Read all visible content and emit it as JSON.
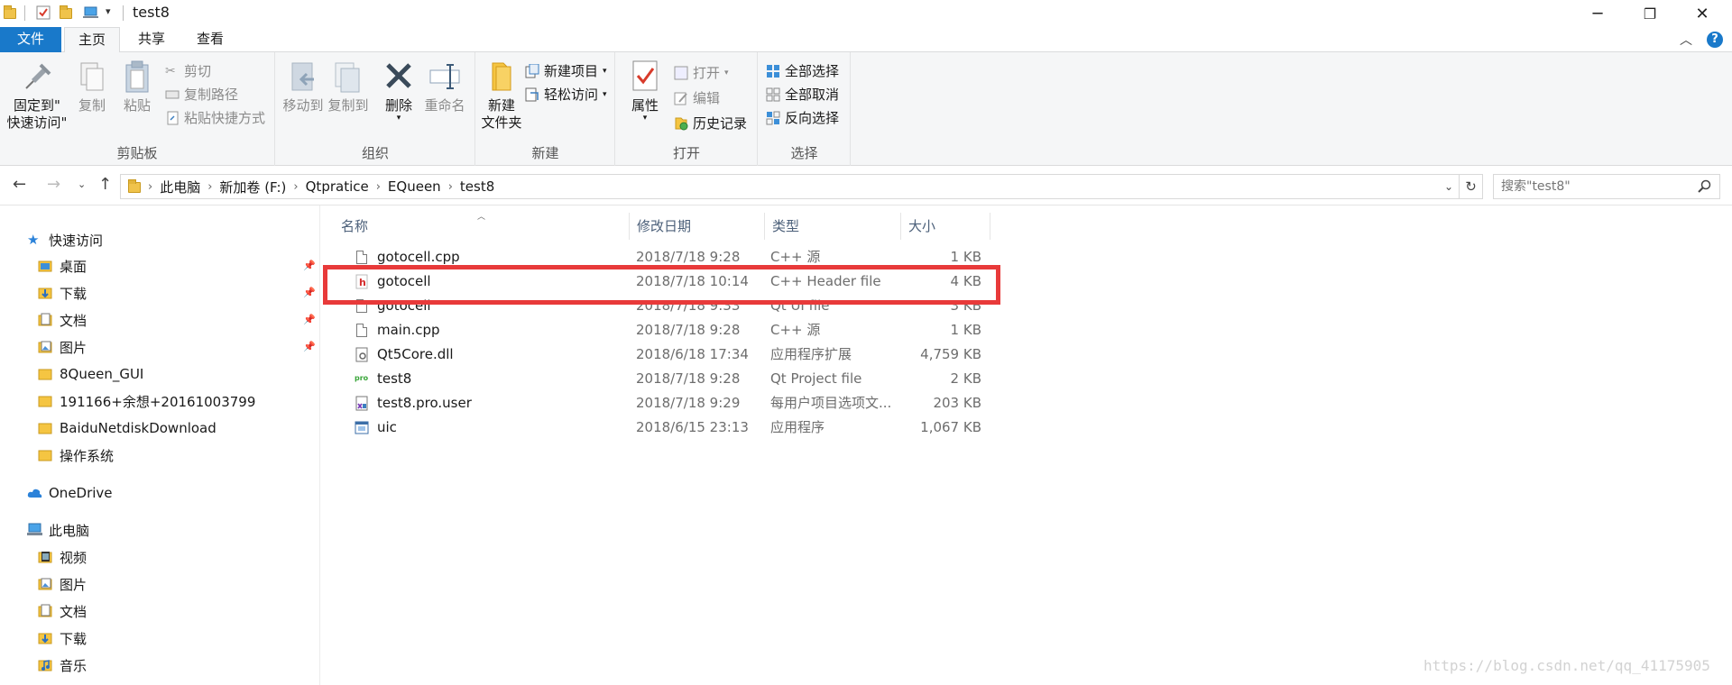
{
  "window": {
    "title": "test8",
    "controls": {
      "minimize": "─",
      "maximize": "❐",
      "close": "✕"
    }
  },
  "ribbon_tabs": [
    {
      "label": "文件"
    },
    {
      "label": "主页"
    },
    {
      "label": "共享"
    },
    {
      "label": "查看"
    }
  ],
  "ribbon": {
    "clipboard": {
      "label": "剪贴板",
      "pin_line1": "固定到\"",
      "pin_line2": "快速访问\"",
      "copy": "复制",
      "paste": "粘贴",
      "cut": "剪切",
      "copy_path": "复制路径",
      "paste_shortcut": "粘贴快捷方式"
    },
    "organize": {
      "label": "组织",
      "move_to": "移动到",
      "copy_to": "复制到",
      "delete": "删除",
      "rename": "重命名"
    },
    "new": {
      "label": "新建",
      "new_folder_line1": "新建",
      "new_folder_line2": "文件夹",
      "new_item": "新建项目",
      "easy_access": "轻松访问"
    },
    "open": {
      "label": "打开",
      "properties": "属性",
      "open": "打开",
      "edit": "编辑",
      "history": "历史记录"
    },
    "select": {
      "label": "选择",
      "select_all": "全部选择",
      "select_none": "全部取消",
      "invert": "反向选择"
    }
  },
  "address": {
    "crumbs": [
      "此电脑",
      "新加卷 (F:)",
      "Qtpratice",
      "EQueen",
      "test8"
    ],
    "search_placeholder": "搜索\"test8\""
  },
  "nav_pane": {
    "quick_access": "快速访问",
    "quick_items": [
      "桌面",
      "下载",
      "文档",
      "图片",
      "8Queen_GUI",
      "191166+余想+20161003799",
      "BaiduNetdiskDownload",
      "操作系统"
    ],
    "onedrive": "OneDrive",
    "this_pc": "此电脑",
    "pc_items": [
      "视频",
      "图片",
      "文档",
      "下载",
      "音乐"
    ]
  },
  "columns": {
    "name": "名称",
    "date": "修改日期",
    "type": "类型",
    "size": "大小"
  },
  "files": [
    {
      "name": "gotocell.cpp",
      "date": "2018/7/18 9:28",
      "type": "C++ 源",
      "size": "1 KB",
      "icon": "cpp-file-icon"
    },
    {
      "name": "gotocell",
      "date": "2018/7/18 10:14",
      "type": "C++ Header file",
      "size": "4 KB",
      "icon": "header-file-icon"
    },
    {
      "name": "gotocell",
      "date": "2018/7/18 9:33",
      "type": "Qt UI file",
      "size": "3 KB",
      "icon": "ui-file-icon"
    },
    {
      "name": "main.cpp",
      "date": "2018/7/18 9:28",
      "type": "C++ 源",
      "size": "1 KB",
      "icon": "cpp-file-icon"
    },
    {
      "name": "Qt5Core.dll",
      "date": "2018/6/18 17:34",
      "type": "应用程序扩展",
      "size": "4,759 KB",
      "icon": "dll-file-icon"
    },
    {
      "name": "test8",
      "date": "2018/7/18 9:28",
      "type": "Qt Project file",
      "size": "2 KB",
      "icon": "pro-file-icon"
    },
    {
      "name": "test8.pro.user",
      "date": "2018/7/18 9:29",
      "type": "每用户项目选项文...",
      "size": "203 KB",
      "icon": "user-file-icon"
    },
    {
      "name": "uic",
      "date": "2018/6/15 23:13",
      "type": "应用程序",
      "size": "1,067 KB",
      "icon": "exe-file-icon"
    }
  ],
  "watermark": "https://blog.csdn.net/qq_41175905",
  "colors": {
    "accent": "#1979ca",
    "highlight_box": "#e83a3a",
    "folder": "#f0c34b"
  }
}
